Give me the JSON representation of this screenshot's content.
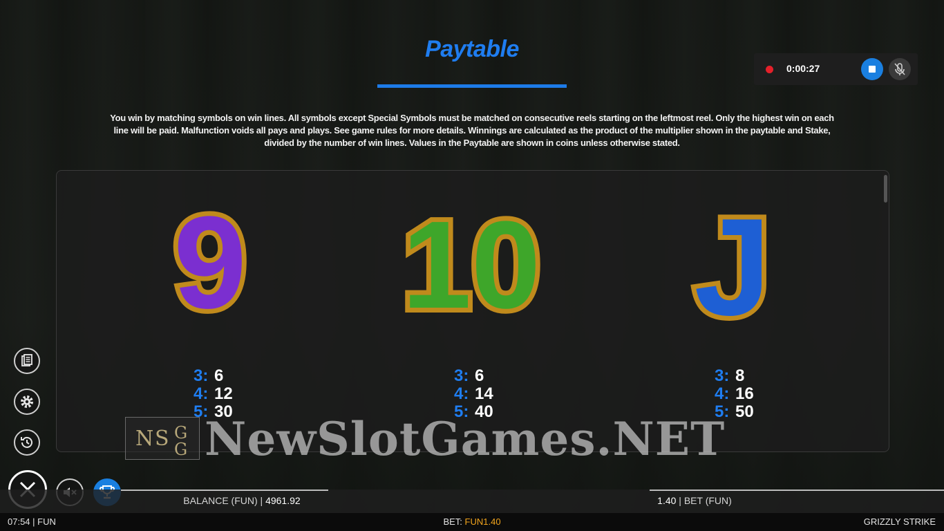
{
  "header": {
    "title": "Paytable",
    "rules_text": "You win by matching symbols on win lines. All symbols except Special Symbols must be matched on consecutive reels starting on the leftmost reel. Only the highest win on each line will be paid. Malfunction voids all pays and plays. See game rules for more details. Winnings are calculated as the product of the multiplier shown in the paytable and Stake, divided by the number of win lines. Values in the Paytable are shown in coins unless otherwise stated."
  },
  "recorder": {
    "time": "0:00:27"
  },
  "symbols": [
    {
      "glyph": "9",
      "color": "#7b2fd0",
      "pays": [
        {
          "k": "3:",
          "v": "6"
        },
        {
          "k": "4:",
          "v": "12"
        },
        {
          "k": "5:",
          "v": "30"
        }
      ]
    },
    {
      "glyph": "10",
      "color": "#3ea62a",
      "pays": [
        {
          "k": "3:",
          "v": "6"
        },
        {
          "k": "4:",
          "v": "14"
        },
        {
          "k": "5:",
          "v": "40"
        }
      ]
    },
    {
      "glyph": "J",
      "color": "#1e5fd4",
      "pays": [
        {
          "k": "3:",
          "v": "8"
        },
        {
          "k": "4:",
          "v": "16"
        },
        {
          "k": "5:",
          "v": "50"
        }
      ]
    }
  ],
  "side_buttons": [
    "paytable-icon",
    "settings-icon",
    "history-icon"
  ],
  "bottom_bar": {
    "balance_label": "BALANCE (FUN)",
    "balance_value": "4961.92",
    "bet_value": "1.40",
    "bet_label": "BET  (FUN)"
  },
  "status_bar": {
    "time": "07:54",
    "mode": "FUN",
    "bet_label": "BET:",
    "bet_amount": "FUN1.40",
    "game_name": "GRIZZLY STRIKE"
  },
  "watermark": {
    "logo_letters": [
      "N",
      "S",
      "G",
      "G"
    ],
    "text": "NewSlotGames.NET"
  },
  "colors": {
    "accent": "#1f7df0",
    "record": "#e5202a",
    "bet_amount": "#f3a51c"
  }
}
